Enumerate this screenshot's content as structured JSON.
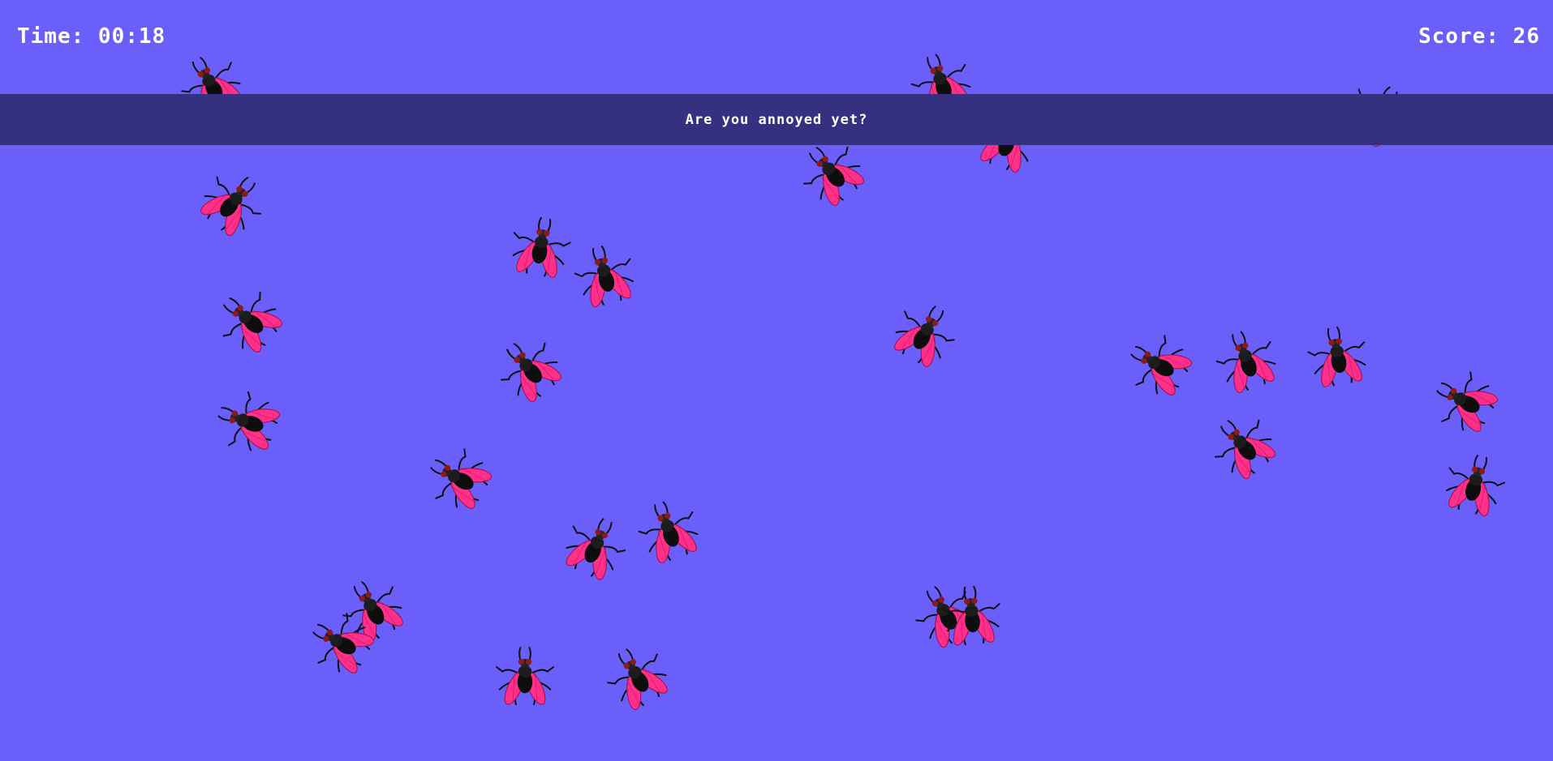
{
  "hud": {
    "time_label": "Time: 00:18",
    "score_label": "Score: 26"
  },
  "banner": {
    "message": "Are you annoyed yet?"
  },
  "colors": {
    "background": "#6a5ffa",
    "banner": "#353080",
    "fly_wing": "#ff2f8a",
    "fly_body": "#0d0d0d"
  },
  "fly_icon": "housefly-icon"
}
